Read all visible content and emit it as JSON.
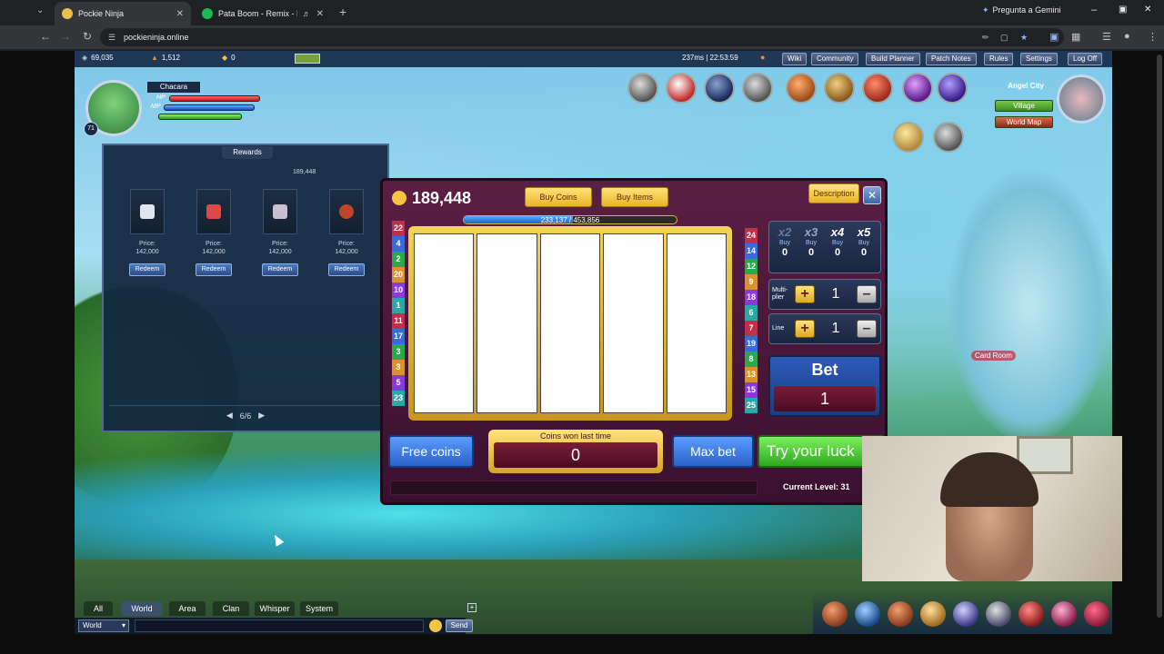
{
  "browser": {
    "tabs": [
      {
        "title": "Pockie Ninja",
        "active": true
      },
      {
        "title": "Pata Boom - Remix - Daddy",
        "active": false
      }
    ],
    "url": "pockieninja.online",
    "gemini_button": "Pregunta a Gemini"
  },
  "hud": {
    "stat1": "69,035",
    "stat2": "1,512",
    "stat3": "0",
    "latency": "237ms | 22:53:59",
    "menu": [
      "Wiki",
      "Community",
      "Build Planner",
      "Patch Notes",
      "Rules",
      "Settings",
      "Log Off"
    ],
    "player_name": "Chacara",
    "player_level": "71",
    "bar_labels": {
      "hp": "HP",
      "mp": "MP"
    }
  },
  "rewards": {
    "title": "Rewards",
    "balance": "189,448",
    "items": [
      {
        "price_label": "Price:",
        "price": "142,000",
        "button": "Redeem",
        "icon_color": "#dfe6ee"
      },
      {
        "price_label": "Price:",
        "price": "142,000",
        "button": "Redeem",
        "icon_color": "#e04848"
      },
      {
        "price_label": "Price:",
        "price": "142,000",
        "button": "Redeem",
        "icon_color": "#c8c0d0"
      },
      {
        "price_label": "Price:",
        "price": "142,000",
        "button": "Redeem",
        "icon_color": "#c0442a"
      }
    ],
    "page": "6/6"
  },
  "slot": {
    "balance": "189,448",
    "buy_coins": "Buy Coins",
    "buy_items": "Buy Items",
    "description": "Description",
    "progress_text": "233,137 / 453,856",
    "progress_fraction": 0.514,
    "left_lines": [
      "22",
      "4",
      "2",
      "20",
      "10",
      "1",
      "11",
      "17",
      "3",
      "3",
      "5",
      "23"
    ],
    "right_lines": [
      "24",
      "14",
      "12",
      "9",
      "18",
      "6",
      "7",
      "19",
      "8",
      "13",
      "15",
      "25"
    ],
    "multipliers": [
      {
        "label": "x2",
        "buy": "Buy",
        "count": "0"
      },
      {
        "label": "x3",
        "buy": "Buy",
        "count": "0"
      },
      {
        "label": "x4",
        "buy": "Buy",
        "count": "0"
      },
      {
        "label": "x5",
        "buy": "Buy",
        "count": "0"
      }
    ],
    "multiplier_label": "Multi-plier",
    "multiplier_value": "1",
    "line_label": "Line",
    "line_value": "1",
    "bet_label": "Bet",
    "bet_value": "1",
    "free_coins": "Free coins",
    "won_label": "Coins won last time",
    "won_value": "0",
    "max_bet": "Max bet",
    "try_luck": "Try your luck",
    "current_level": "Current Level: 31"
  },
  "location": {
    "name": "Angel City",
    "village": "Village",
    "world_map": "World Map",
    "room_label": "Card Room"
  },
  "chat": {
    "tabs": [
      "All",
      "World",
      "Area",
      "Clan",
      "Whisper",
      "System"
    ],
    "active_tab": "World",
    "channel": "World",
    "send": "Send"
  }
}
